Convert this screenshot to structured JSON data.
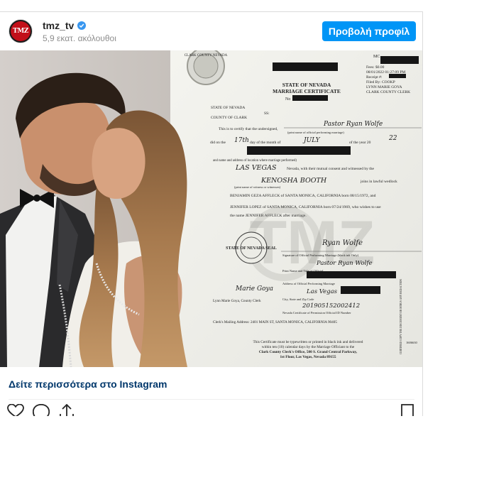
{
  "account": {
    "username": "tmz_tv",
    "followers": "5,9 εκατ. ακόλουθοι",
    "avatar_text": "TMZ",
    "profile_button": "Προβολή προφίλ"
  },
  "post": {
    "see_more_link": "Δείτε περισσότερα στο Instagram"
  },
  "document": {
    "seal_text": "CLARK COUNTY NEVADA",
    "mc_label": "MC",
    "fees": "Fees: $0.00",
    "date": "08/01/2022 01:27:09 PM",
    "receipt": "Receipt #:",
    "filed_by": "Filed By: COOKP",
    "clerk_name": "LYNN MARIE GOYA",
    "clerk_title": "CLARK COUNTY CLERK",
    "title_line1": "STATE OF NEVADA",
    "title_line2": "MARRIAGE CERTIFICATE",
    "no_label": "No",
    "state_label": "STATE OF NEVADA",
    "county_label": "COUNTY OF CLARK",
    "ss_label": "SS:",
    "certify_text": "This is to certify that the undersigned,",
    "officiant": "Pastor Ryan Wolfe",
    "print_officiant": "(print name of official performing marriage)",
    "did_on_the": "did on the",
    "day": "17th",
    "day_of_month": "day of the month of",
    "month": "JULY",
    "year_of": "of the year 20",
    "year": "22",
    "and_name": "and name and address of location where marriage performed)",
    "location": "LAS VEGAS",
    "nevada_consent": "Nevada, with their mutual consent and witnessed by the",
    "witness": "KENOSHA BOOTH",
    "lawful": "joins in lawful wedlock",
    "print_witness": "(print name of witness or witnesses)",
    "groom_line": "BENJAMIN GEZA AFFLECK of SANTA MONICA, CALIFORNIA born 08/15/1972, and",
    "bride_line": "JENNIFER LOPEZ of SANTA MONICA, CALIFORNIA born 07/24/1969, who wishes to use",
    "new_name_line": "the name JENNIFER AFFLECK after marriage.",
    "sig_officiant": "Ryan Wolfe",
    "sig_officiant_label": "Signature of Official Performing Marriage (black ink Only)",
    "print_officiant2": "Pastor Ryan Wolfe",
    "print_name_title": "Print Name and Title of Official",
    "address_label": "Address of Official Performing Marriage",
    "city": "Las Vegas",
    "city_label": "City, State and Zip Code",
    "permission_id": "201905152002412",
    "permission_label": "Nevada Certificate of Permission Official ID Number",
    "seal_label": "STATE OF NEVADA SEAL",
    "clerk_sig": "Marie Goya",
    "clerk_caption": "Lynn Marie Goya, County Clerk",
    "mailing": "Clerk's Mailing Address: 2401 MAIN ST, SANTA MONICA, CALIFORNIA 90405",
    "footer1": "This Certificate must be typewritten or printed in black ink and delivered",
    "footer2": "within ten (10) calendar days by the Marriage Officiant to the",
    "footer3": "Clark County Clerk's Office, 500 S. Grand Central Parkway,",
    "footer4": "1st Floor, Las Vegas, Nevada 89155",
    "side_note": "CERTIFIED COPY THE DOCUMENT OR MINUS ANY REDACTION",
    "side_number": "1606630",
    "watermark": "TMZ"
  },
  "colors": {
    "primary_button": "#0095f6",
    "link": "#00376b",
    "verified": "#3897f0",
    "brand_red": "#c2101a"
  },
  "icons": [
    "verified-badge-icon",
    "heart-icon",
    "comment-icon",
    "share-icon",
    "bookmark-icon"
  ]
}
